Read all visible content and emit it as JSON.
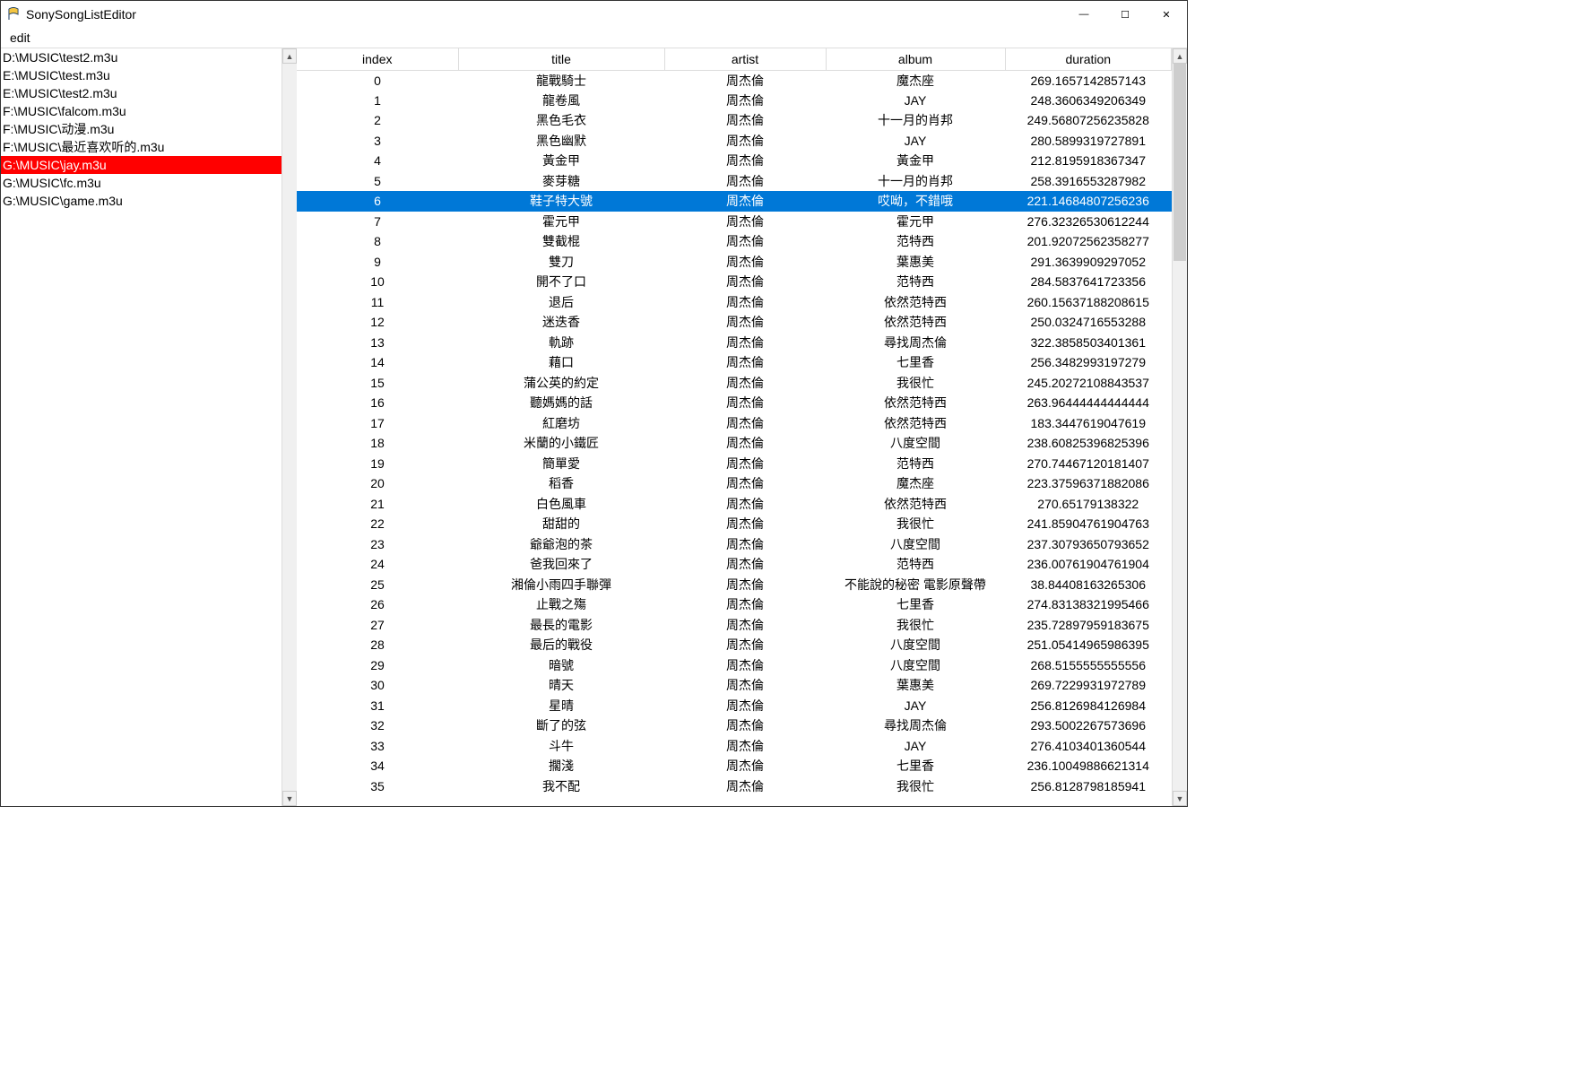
{
  "window": {
    "title": "SonySongListEditor",
    "menu": {
      "edit": "edit"
    }
  },
  "sidebar": {
    "selectedIndex": 6,
    "items": [
      "D:\\MUSIC\\test2.m3u",
      "E:\\MUSIC\\test.m3u",
      "E:\\MUSIC\\test2.m3u",
      "F:\\MUSIC\\falcom.m3u",
      "F:\\MUSIC\\动漫.m3u",
      "F:\\MUSIC\\最近喜欢听的.m3u",
      "G:\\MUSIC\\jay.m3u",
      "G:\\MUSIC\\fc.m3u",
      "G:\\MUSIC\\game.m3u"
    ]
  },
  "table": {
    "headers": {
      "index": "index",
      "title": "title",
      "artist": "artist",
      "album": "album",
      "duration": "duration"
    },
    "selectedIndex": 6,
    "rows": [
      {
        "index": "0",
        "title": "龍戰騎士",
        "artist": "周杰倫",
        "album": "魔杰座",
        "duration": "269.1657142857143"
      },
      {
        "index": "1",
        "title": "龍卷風",
        "artist": "周杰倫",
        "album": "JAY",
        "duration": "248.3606349206349"
      },
      {
        "index": "2",
        "title": "黑色毛衣",
        "artist": "周杰倫",
        "album": "十一月的肖邦",
        "duration": "249.56807256235828"
      },
      {
        "index": "3",
        "title": "黑色幽默",
        "artist": "周杰倫",
        "album": "JAY",
        "duration": "280.5899319727891"
      },
      {
        "index": "4",
        "title": "黃金甲",
        "artist": "周杰倫",
        "album": "黃金甲",
        "duration": "212.8195918367347"
      },
      {
        "index": "5",
        "title": "麥芽糖",
        "artist": "周杰倫",
        "album": "十一月的肖邦",
        "duration": "258.3916553287982"
      },
      {
        "index": "6",
        "title": "鞋子特大號",
        "artist": "周杰倫",
        "album": "哎呦，不錯哦",
        "duration": "221.14684807256236"
      },
      {
        "index": "7",
        "title": "霍元甲",
        "artist": "周杰倫",
        "album": "霍元甲",
        "duration": "276.32326530612244"
      },
      {
        "index": "8",
        "title": "雙截棍",
        "artist": "周杰倫",
        "album": "范特西",
        "duration": "201.92072562358277"
      },
      {
        "index": "9",
        "title": "雙刀",
        "artist": "周杰倫",
        "album": "葉惠美",
        "duration": "291.3639909297052"
      },
      {
        "index": "10",
        "title": "開不了口",
        "artist": "周杰倫",
        "album": "范特西",
        "duration": "284.5837641723356"
      },
      {
        "index": "11",
        "title": "退后",
        "artist": "周杰倫",
        "album": "依然范特西",
        "duration": "260.15637188208615"
      },
      {
        "index": "12",
        "title": "迷迭香",
        "artist": "周杰倫",
        "album": "依然范特西",
        "duration": "250.0324716553288"
      },
      {
        "index": "13",
        "title": "軌跡",
        "artist": "周杰倫",
        "album": "尋找周杰倫",
        "duration": "322.3858503401361"
      },
      {
        "index": "14",
        "title": "藉口",
        "artist": "周杰倫",
        "album": "七里香",
        "duration": "256.3482993197279"
      },
      {
        "index": "15",
        "title": "蒲公英的約定",
        "artist": "周杰倫",
        "album": "我很忙",
        "duration": "245.20272108843537"
      },
      {
        "index": "16",
        "title": "聽媽媽的話",
        "artist": "周杰倫",
        "album": "依然范特西",
        "duration": "263.96444444444444"
      },
      {
        "index": "17",
        "title": "紅磨坊",
        "artist": "周杰倫",
        "album": "依然范特西",
        "duration": "183.3447619047619"
      },
      {
        "index": "18",
        "title": "米蘭的小鐵匠",
        "artist": "周杰倫",
        "album": "八度空間",
        "duration": "238.60825396825396"
      },
      {
        "index": "19",
        "title": "簡單愛",
        "artist": "周杰倫",
        "album": "范特西",
        "duration": "270.74467120181407"
      },
      {
        "index": "20",
        "title": "稻香",
        "artist": "周杰倫",
        "album": "魔杰座",
        "duration": "223.37596371882086"
      },
      {
        "index": "21",
        "title": "白色風車",
        "artist": "周杰倫",
        "album": "依然范特西",
        "duration": "270.65179138322"
      },
      {
        "index": "22",
        "title": "甜甜的",
        "artist": "周杰倫",
        "album": "我很忙",
        "duration": "241.85904761904763"
      },
      {
        "index": "23",
        "title": "爺爺泡的茶",
        "artist": "周杰倫",
        "album": "八度空間",
        "duration": "237.30793650793652"
      },
      {
        "index": "24",
        "title": "爸我回來了",
        "artist": "周杰倫",
        "album": "范特西",
        "duration": "236.00761904761904"
      },
      {
        "index": "25",
        "title": "湘倫小雨四手聯彈",
        "artist": "周杰倫",
        "album": "不能說的秘密 電影原聲帶",
        "duration": "38.84408163265306"
      },
      {
        "index": "26",
        "title": "止戰之殤",
        "artist": "周杰倫",
        "album": "七里香",
        "duration": "274.83138321995466"
      },
      {
        "index": "27",
        "title": "最長的電影",
        "artist": "周杰倫",
        "album": "我很忙",
        "duration": "235.72897959183675"
      },
      {
        "index": "28",
        "title": "最后的戰役",
        "artist": "周杰倫",
        "album": "八度空間",
        "duration": "251.05414965986395"
      },
      {
        "index": "29",
        "title": "暗號",
        "artist": "周杰倫",
        "album": "八度空間",
        "duration": "268.5155555555556"
      },
      {
        "index": "30",
        "title": "晴天",
        "artist": "周杰倫",
        "album": "葉惠美",
        "duration": "269.7229931972789"
      },
      {
        "index": "31",
        "title": "星晴",
        "artist": "周杰倫",
        "album": "JAY",
        "duration": "256.8126984126984"
      },
      {
        "index": "32",
        "title": "斷了的弦",
        "artist": "周杰倫",
        "album": "尋找周杰倫",
        "duration": "293.5002267573696"
      },
      {
        "index": "33",
        "title": "斗牛",
        "artist": "周杰倫",
        "album": "JAY",
        "duration": "276.4103401360544"
      },
      {
        "index": "34",
        "title": "擱淺",
        "artist": "周杰倫",
        "album": "七里香",
        "duration": "236.10049886621314"
      },
      {
        "index": "35",
        "title": "我不配",
        "artist": "周杰倫",
        "album": "我很忙",
        "duration": "256.8128798185941"
      }
    ]
  }
}
